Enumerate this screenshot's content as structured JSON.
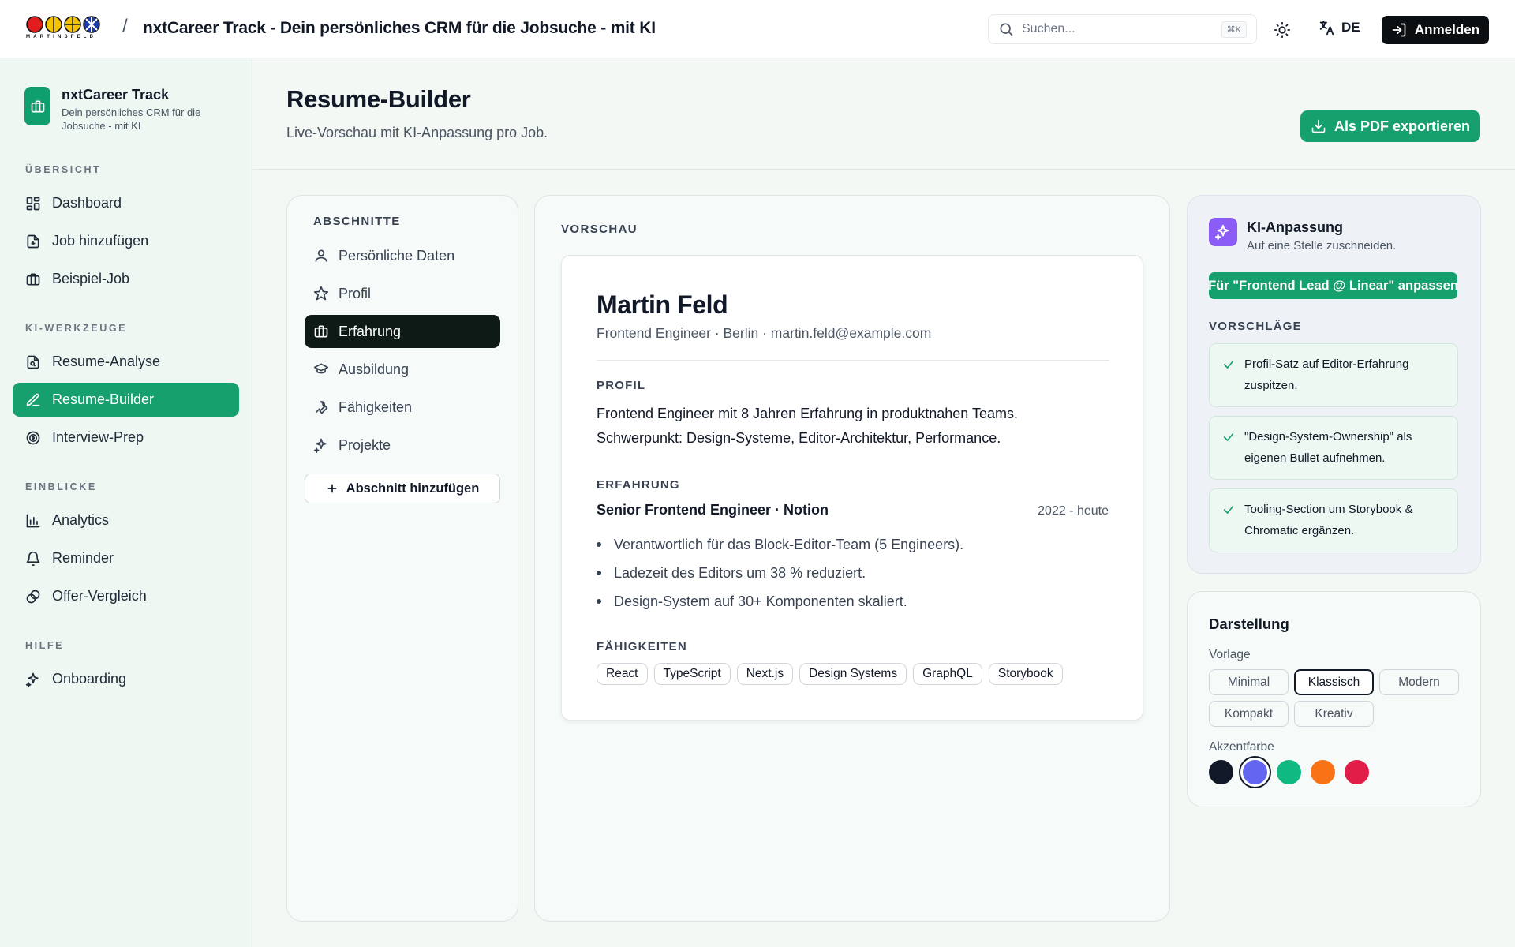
{
  "topbar": {
    "logo_text": "MARTINSFELD",
    "separator": "/",
    "app_title": "nxtCareer Track - Dein persönliches CRM für die Jobsuche - mit KI",
    "search_placeholder": "Suchen...",
    "search_shortcut": "⌘K",
    "language": "DE",
    "login_label": "Anmelden"
  },
  "sidebar": {
    "brand_name": "nxtCareer Track",
    "brand_sub": "Dein persönliches CRM für die Jobsuche - mit KI",
    "sections": [
      {
        "label": "ÜBERSICHT",
        "items": [
          {
            "label": "Dashboard",
            "icon": "dashboard-icon"
          },
          {
            "label": "Job hinzufügen",
            "icon": "file-plus-icon"
          },
          {
            "label": "Beispiel-Job",
            "icon": "briefcase-icon"
          }
        ]
      },
      {
        "label": "KI-WERKZEUGE",
        "items": [
          {
            "label": "Resume-Analyse",
            "icon": "file-search-icon"
          },
          {
            "label": "Resume-Builder",
            "icon": "pen-icon",
            "active": true
          },
          {
            "label": "Interview-Prep",
            "icon": "target-icon"
          }
        ]
      },
      {
        "label": "EINBLICKE",
        "items": [
          {
            "label": "Analytics",
            "icon": "bar-chart-icon"
          },
          {
            "label": "Reminder",
            "icon": "bell-icon"
          },
          {
            "label": "Offer-Vergleich",
            "icon": "coins-icon"
          }
        ]
      },
      {
        "label": "HILFE",
        "items": [
          {
            "label": "Onboarding",
            "icon": "sparkles-icon"
          }
        ]
      }
    ]
  },
  "header": {
    "title": "Resume-Builder",
    "subtitle": "Live-Vorschau mit KI-Anpassung pro Job.",
    "export_label": "Als PDF exportieren"
  },
  "sections_panel": {
    "label": "ABSCHNITTE",
    "items": [
      {
        "label": "Persönliche Daten",
        "icon": "user-icon"
      },
      {
        "label": "Profil",
        "icon": "star-icon"
      },
      {
        "label": "Erfahrung",
        "icon": "briefcase-icon",
        "active": true
      },
      {
        "label": "Ausbildung",
        "icon": "graduation-cap-icon"
      },
      {
        "label": "Fähigkeiten",
        "icon": "wrench-icon"
      },
      {
        "label": "Projekte",
        "icon": "sparkles-icon"
      }
    ],
    "add_label": "Abschnitt hinzufügen"
  },
  "preview": {
    "label": "VORSCHAU",
    "name": "Martin Feld",
    "meta": "Frontend Engineer · Berlin · martin.feld@example.com",
    "profile_heading": "PROFIL",
    "profile_line1": "Frontend Engineer mit 8 Jahren Erfahrung in produktnahen Teams.",
    "profile_line2": "Schwerpunkt: Design-Systeme, Editor-Architektur, Performance.",
    "experience_heading": "ERFAHRUNG",
    "job_title": "Senior Frontend Engineer · Notion",
    "job_dates": "2022 - heute",
    "bullets": [
      "Verantwortlich für das Block-Editor-Team (5 Engineers).",
      "Ladezeit des Editors um 38 % reduziert.",
      "Design-System auf 30+ Komponenten skaliert."
    ],
    "skills_heading": "FÄHIGKEITEN",
    "skills": [
      "React",
      "TypeScript",
      "Next.js",
      "Design Systems",
      "GraphQL",
      "Storybook"
    ]
  },
  "ai_panel": {
    "title": "KI-Anpassung",
    "subtitle": "Auf eine Stelle zuschneiden.",
    "adapt_label": "Für \"Frontend Lead @ Linear\" anpassen",
    "suggestions_label": "VORSCHLÄGE",
    "suggestions": [
      {
        "line1": "Profil-Satz auf Editor-Erfahrung",
        "line2": "zuspitzen."
      },
      {
        "line1": "\"Design-System-Ownership\" als",
        "line2": "eigenen Bullet aufnehmen."
      },
      {
        "line1": "Tooling-Section um Storybook &",
        "line2": "Chromatic ergänzen."
      }
    ]
  },
  "display_panel": {
    "title": "Darstellung",
    "template_label": "Vorlage",
    "templates": [
      "Minimal",
      "Klassisch",
      "Modern",
      "Kompakt",
      "Kreativ"
    ],
    "selected_template": "Klassisch",
    "accent_label": "Akzentfarbe",
    "accent_colors": [
      "#111827",
      "#6366f1",
      "#10b981",
      "#f97316",
      "#e11d48"
    ],
    "selected_accent": "#6366f1"
  },
  "colors": {
    "brand_green": "#16a06e",
    "dark": "#0e1a15",
    "ai_purple": "#8b5cf6"
  }
}
